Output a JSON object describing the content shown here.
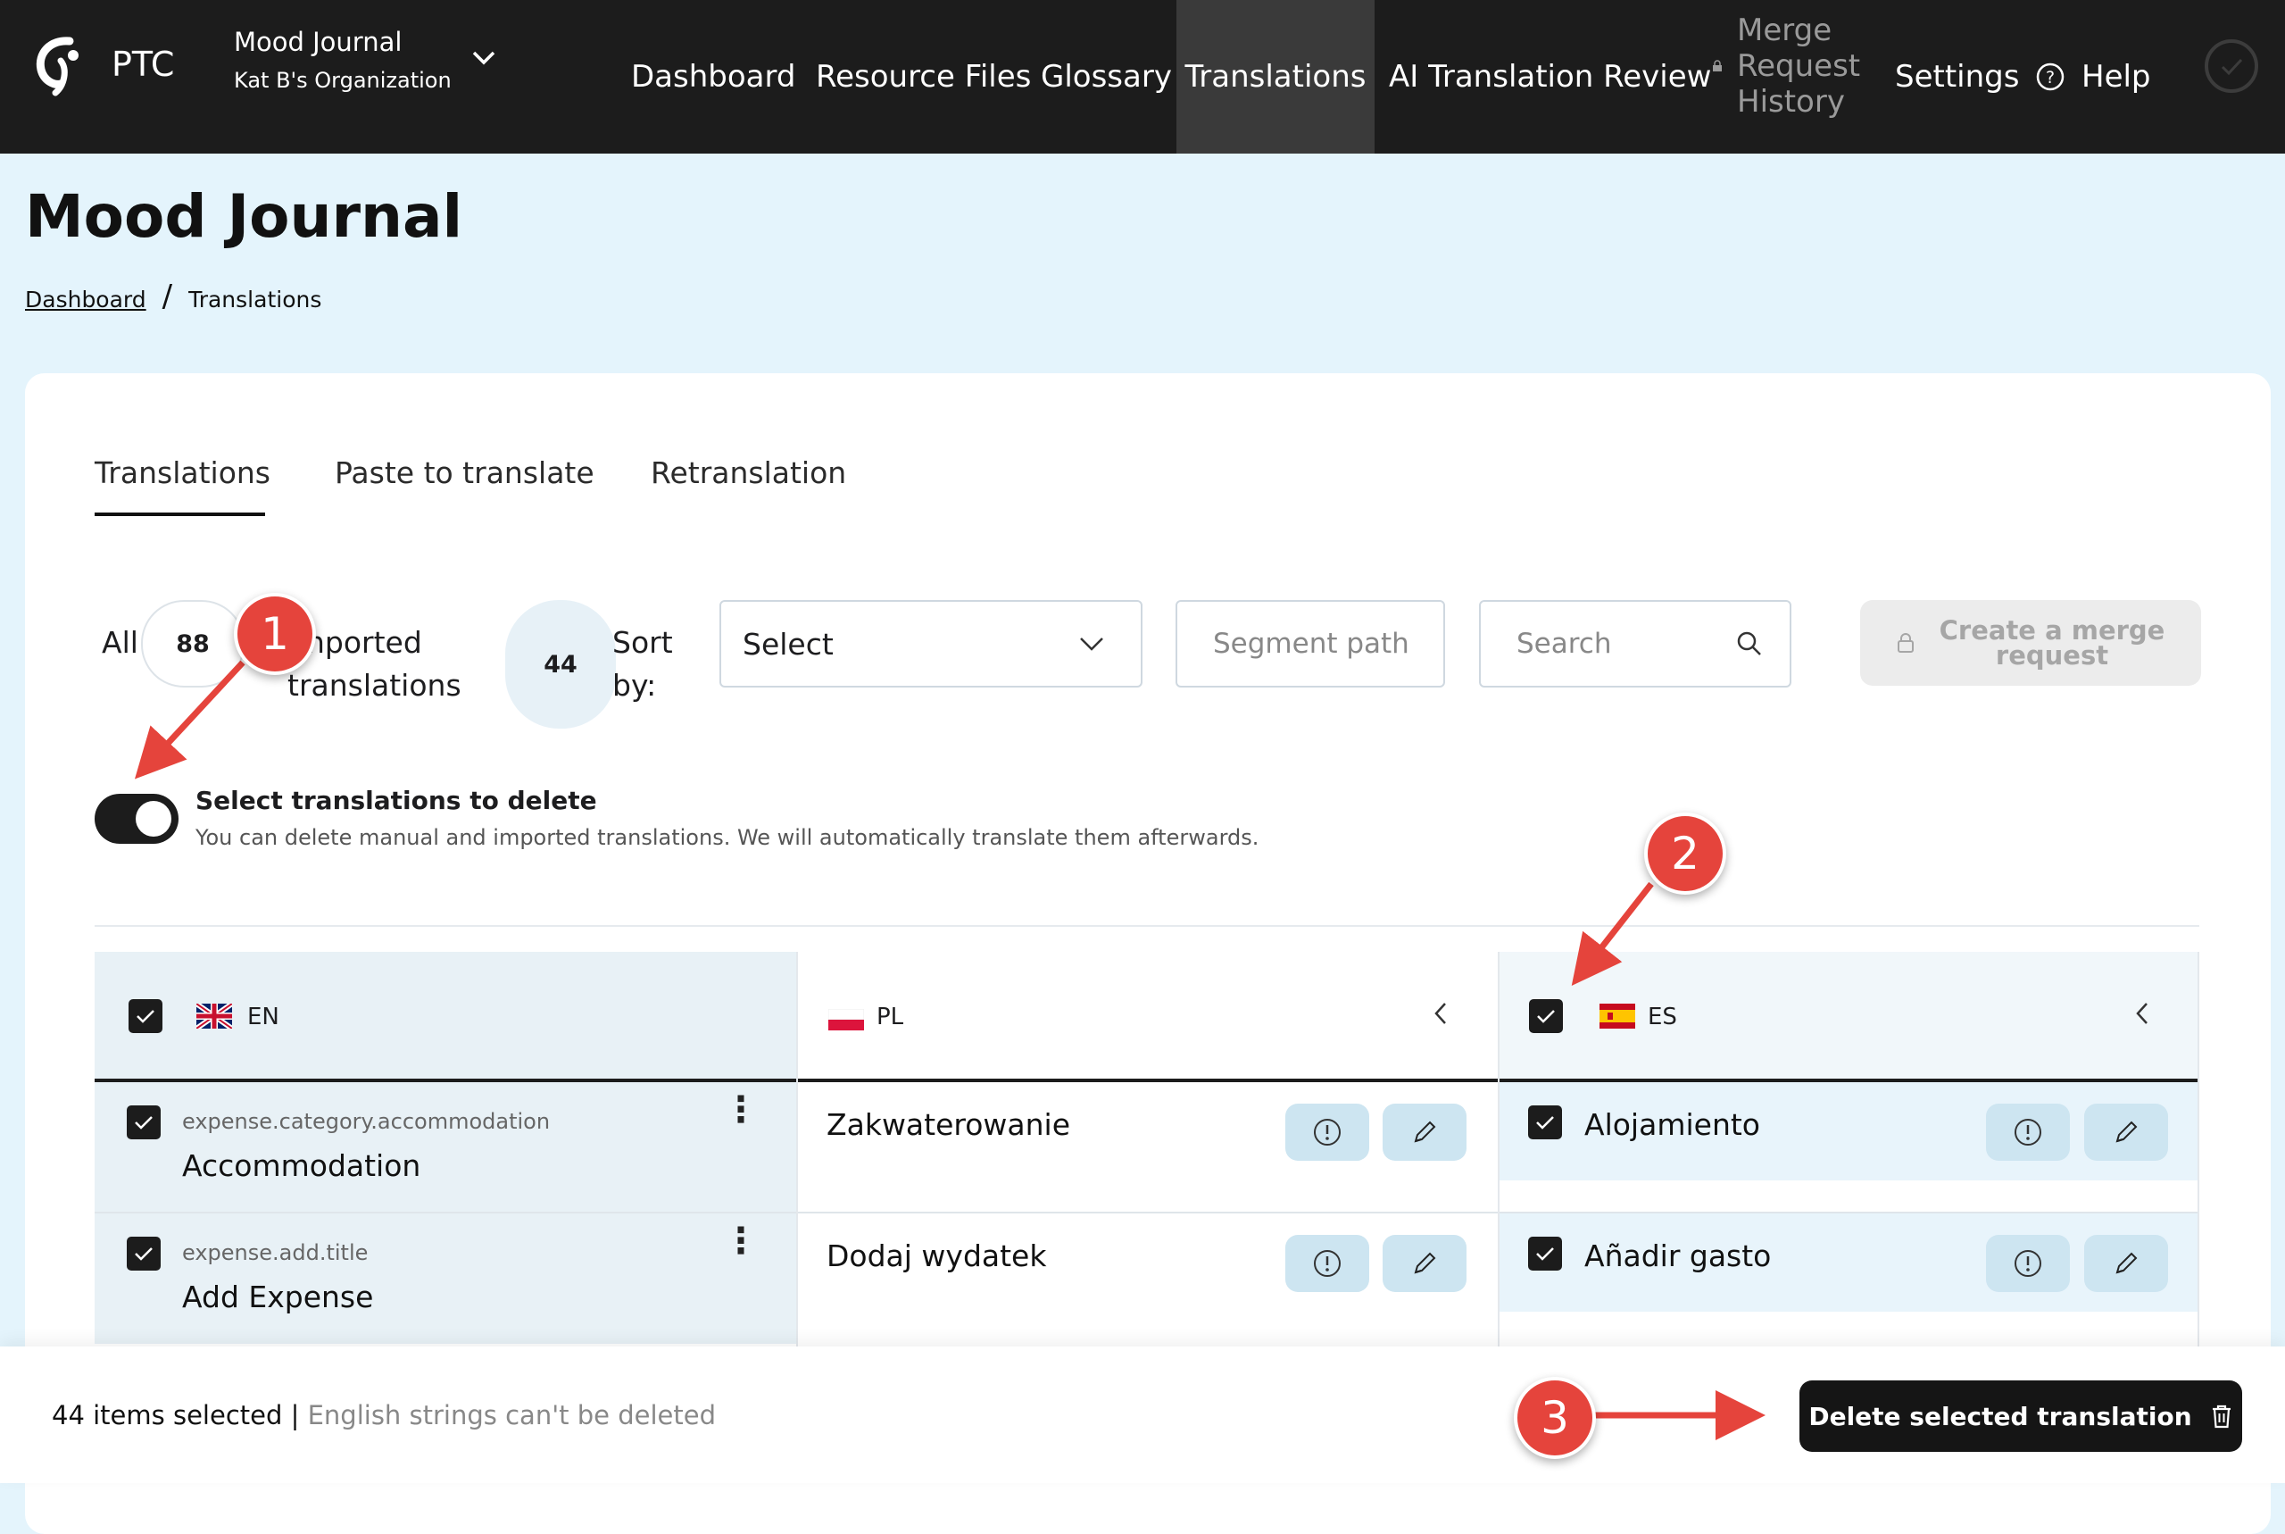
{
  "brand": {
    "name": "PTC",
    "logo_icon": "ptc-logo-icon"
  },
  "project_switcher": {
    "project": "Mood Journal",
    "organization": "Kat B's Organization",
    "icon": "chevron-down-icon"
  },
  "nav": {
    "dashboard": "Dashboard",
    "resource_files": "Resource Files",
    "glossary": "Glossary",
    "translations": "Translations",
    "ai_review": "AI Translation Review",
    "merge_line1": "Merge",
    "merge_line2": "Request",
    "merge_line3": "History",
    "settings": "Settings",
    "help": "Help"
  },
  "page": {
    "title": "Mood Journal"
  },
  "breadcrumb": {
    "root": "Dashboard",
    "separator": "/",
    "current": "Translations"
  },
  "tabs": [
    "Translations",
    "Paste to translate",
    "Retranslation"
  ],
  "filters": {
    "all_label": "All",
    "all_count": "88",
    "imported_line1": "Imported",
    "imported_line2": "translations",
    "imported_count": "44",
    "sort_line1": "Sort",
    "sort_line2": "by:",
    "sort_value": "Select",
    "segment_path_placeholder": "Segment path",
    "search_placeholder": "Search",
    "merge_line1": "Create a merge",
    "merge_line2": "request"
  },
  "toggle": {
    "on": true,
    "title": "Select translations to delete",
    "description": "You can delete manual and imported translations. We will automatically translate them afterwards."
  },
  "columns": {
    "en": {
      "code": "EN",
      "checked": true
    },
    "pl": {
      "code": "PL"
    },
    "es": {
      "code": "ES",
      "checked": true
    }
  },
  "rows": [
    {
      "key": "expense.category.accommodation",
      "source": "Accommodation",
      "pl": "Zakwaterowanie",
      "es": "Alojamiento",
      "checked": true,
      "es_checked": true
    },
    {
      "key": "expense.add.title",
      "source": "Add Expense",
      "pl": "Dodaj wydatek",
      "es": "Añadir gasto",
      "checked": true,
      "es_checked": true
    }
  ],
  "footer": {
    "count": "44 items selected |",
    "note": "English strings can't be deleted",
    "delete_label": "Delete selected translation"
  },
  "annotations": {
    "badge1": "1",
    "badge2": "2",
    "badge3": "3"
  },
  "colors": {
    "navbar": "#1c1c1c",
    "page_bg": "#e4f4fc",
    "annotation_red": "#e5443c",
    "action_button": "#cde5f1"
  }
}
